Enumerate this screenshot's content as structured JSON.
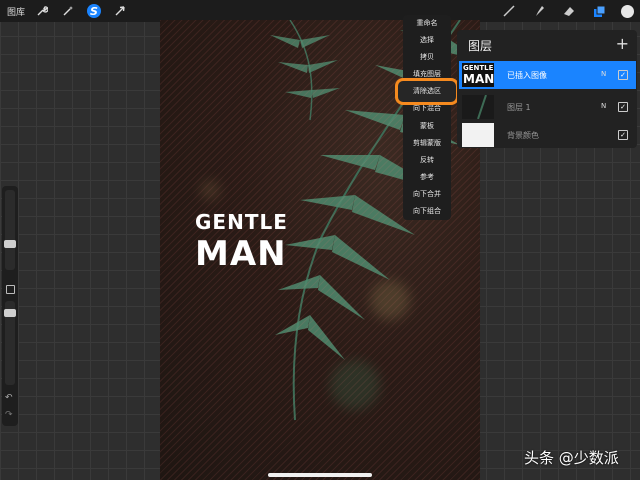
{
  "topbar": {
    "gallery_label": "图库",
    "left_icons": [
      "wrench-icon",
      "magic-wand-icon",
      "selection-s-icon",
      "transform-arrow-icon"
    ],
    "right_icons": [
      "brush-icon",
      "smudge-icon",
      "eraser-icon",
      "layers-icon"
    ],
    "color_swatch": "#e6e6e6",
    "active_color": "#1a84ff"
  },
  "canvas": {
    "text_line1": "GENTLE",
    "text_line2": "MAN"
  },
  "layer_menu": {
    "items": [
      "重命名",
      "选择",
      "拷贝",
      "填充图层",
      "清除选区",
      "向下混合",
      "蒙板",
      "剪辑蒙版",
      "反转",
      "参考",
      "向下合并",
      "向下组合"
    ],
    "highlighted_index": 4,
    "highlight_color": "#f58a1f"
  },
  "layers_panel": {
    "title": "图层",
    "add_label": "+",
    "layers": [
      {
        "name": "已插入图像",
        "mode": "N",
        "visible": true,
        "selected": true,
        "thumb_line1": "GENTLE",
        "thumb_line2": "MAN"
      },
      {
        "name": "图层 1",
        "mode": "N",
        "visible": true,
        "selected": false
      },
      {
        "name": "背景颜色",
        "mode": "",
        "visible": true,
        "selected": false
      }
    ]
  },
  "watermark": "头条 @少数派"
}
